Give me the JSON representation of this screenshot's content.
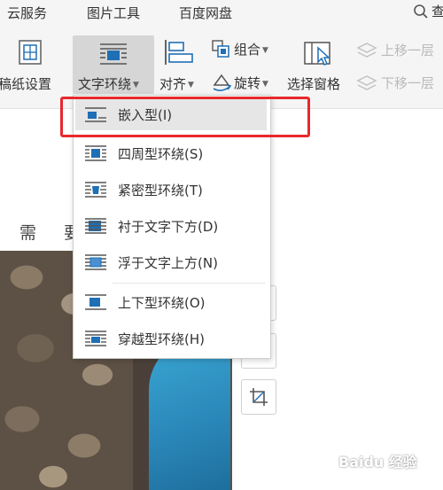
{
  "menu": {
    "tabs": [
      "云服务",
      "图片工具",
      "百度网盘"
    ],
    "search_partial": "查"
  },
  "ribbon": {
    "paper_settings": "稿纸设置",
    "text_wrap": "文字环绕",
    "align": "对齐",
    "group": "组合",
    "rotate": "旋转",
    "select_pane": "选择窗格",
    "move_up": "上移一层",
    "move_down": "下移一层"
  },
  "document": {
    "char1": "需",
    "char2": "要"
  },
  "dropdown": {
    "items": [
      {
        "label": "嵌入型(I)",
        "icon": "inline-wrap-icon",
        "selected": true
      },
      {
        "label": "四周型环绕(S)",
        "icon": "square-wrap-icon",
        "selected": false
      },
      {
        "label": "紧密型环绕(T)",
        "icon": "tight-wrap-icon",
        "selected": false
      },
      {
        "label": "衬于文字下方(D)",
        "icon": "behind-text-icon",
        "selected": false
      },
      {
        "label": "浮于文字上方(N)",
        "icon": "in-front-text-icon",
        "selected": false
      },
      {
        "label": "上下型环绕(O)",
        "icon": "top-bottom-wrap-icon",
        "selected": false
      },
      {
        "label": "穿越型环绕(H)",
        "icon": "through-wrap-icon",
        "selected": false
      }
    ]
  },
  "watermark": "Baidu 经验",
  "colors": {
    "highlight": "#e8282b",
    "icon_blue": "#1f6fb5",
    "ribbon_bg": "#f5f5f5"
  }
}
